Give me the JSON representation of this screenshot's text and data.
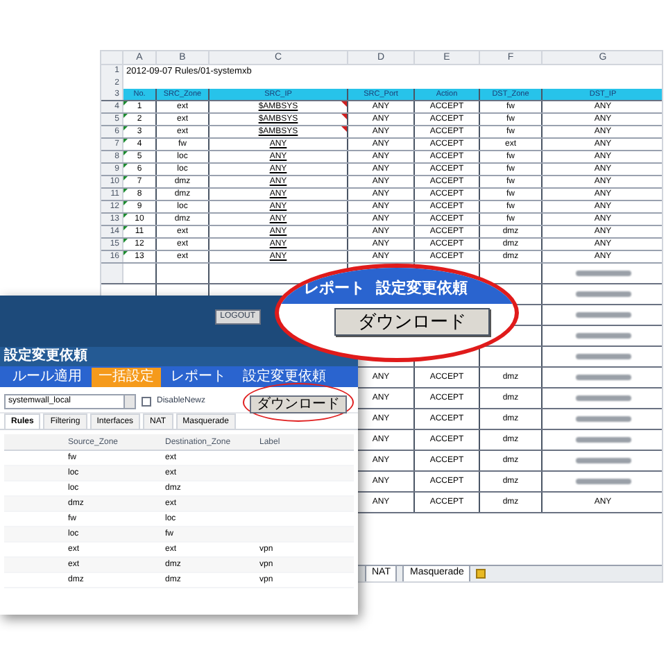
{
  "spreadsheet": {
    "column_headers": [
      "A",
      "B",
      "C",
      "D",
      "E",
      "F",
      "G"
    ],
    "title_row_number": "1",
    "blank_row_number": "2",
    "header_row_number": "3",
    "title": "2012-09-07  Rules/01-systemxb",
    "header": [
      "No.",
      "SRC_Zone",
      "SRC_IP",
      "SRC_Port",
      "Action",
      "DST_Zone",
      "DST_IP"
    ],
    "rows": [
      {
        "row_number": "4",
        "cells": [
          "1",
          "ext",
          "$AMBSYS",
          "ANY",
          "ACCEPT",
          "fw",
          "ANY"
        ],
        "comment": true
      },
      {
        "row_number": "5",
        "cells": [
          "2",
          "ext",
          "$AMBSYS",
          "ANY",
          "ACCEPT",
          "fw",
          "ANY"
        ],
        "comment": true
      },
      {
        "row_number": "6",
        "cells": [
          "3",
          "ext",
          "$AMBSYS",
          "ANY",
          "ACCEPT",
          "fw",
          "ANY"
        ],
        "comment": true
      },
      {
        "row_number": "7",
        "cells": [
          "4",
          "fw",
          "ANY",
          "ANY",
          "ACCEPT",
          "ext",
          "ANY"
        ],
        "comment": false
      },
      {
        "row_number": "8",
        "cells": [
          "5",
          "loc",
          "ANY",
          "ANY",
          "ACCEPT",
          "fw",
          "ANY"
        ],
        "comment": false
      },
      {
        "row_number": "9",
        "cells": [
          "6",
          "loc",
          "ANY",
          "ANY",
          "ACCEPT",
          "fw",
          "ANY"
        ],
        "comment": false
      },
      {
        "row_number": "10",
        "cells": [
          "7",
          "dmz",
          "ANY",
          "ANY",
          "ACCEPT",
          "fw",
          "ANY"
        ],
        "comment": false
      },
      {
        "row_number": "11",
        "cells": [
          "8",
          "dmz",
          "ANY",
          "ANY",
          "ACCEPT",
          "fw",
          "ANY"
        ],
        "comment": false
      },
      {
        "row_number": "12",
        "cells": [
          "9",
          "loc",
          "ANY",
          "ANY",
          "ACCEPT",
          "fw",
          "ANY"
        ],
        "comment": false
      },
      {
        "row_number": "13",
        "cells": [
          "10",
          "dmz",
          "ANY",
          "ANY",
          "ACCEPT",
          "fw",
          "ANY"
        ],
        "comment": false
      },
      {
        "row_number": "14",
        "cells": [
          "11",
          "ext",
          "ANY",
          "ANY",
          "ACCEPT",
          "dmz",
          "ANY"
        ],
        "comment": false
      },
      {
        "row_number": "15",
        "cells": [
          "12",
          "ext",
          "ANY",
          "ANY",
          "ACCEPT",
          "dmz",
          "ANY"
        ],
        "comment": false
      },
      {
        "row_number": "16",
        "cells": [
          "13",
          "ext",
          "ANY",
          "ANY",
          "ACCEPT",
          "dmz",
          "ANY"
        ],
        "comment": false
      }
    ],
    "lower_rows": [
      {
        "kind": "covered"
      },
      {
        "kind": "covered"
      },
      {
        "kind": "covered"
      },
      {
        "kind": "covered"
      },
      {
        "kind": "covered"
      },
      {
        "kind": "full",
        "src_port": "ANY",
        "action": "ACCEPT",
        "dst_zone": "dmz"
      },
      {
        "kind": "full",
        "src_port": "ANY",
        "action": "ACCEPT",
        "dst_zone": "dmz"
      },
      {
        "kind": "full",
        "src_port": "ANY",
        "action": "ACCEPT",
        "dst_zone": "dmz"
      },
      {
        "kind": "full",
        "src_port": "ANY",
        "action": "ACCEPT",
        "dst_zone": "dmz"
      },
      {
        "kind": "full",
        "src_port": "ANY",
        "action": "ACCEPT",
        "dst_zone": "dmz"
      },
      {
        "kind": "full",
        "src_port": "ANY",
        "action": "ACCEPT",
        "dst_zone": "dmz"
      },
      {
        "kind": "full",
        "src_port": "ANY",
        "action": "ACCEPT",
        "dst_zone": "dmz",
        "dst_ip": "ANY"
      }
    ],
    "sheet_tabs": [
      "NAT",
      "Masquerade"
    ]
  },
  "web_window": {
    "header_button": "LOGOUT",
    "title": "設定変更依頼",
    "nav": [
      {
        "label": "ルール適用",
        "selected": false
      },
      {
        "label": "一括設定",
        "selected": true
      },
      {
        "label": "レポート",
        "selected": false
      },
      {
        "label": "設定変更依頼",
        "selected": false
      }
    ],
    "select": {
      "value": "systemwall_local"
    },
    "checkbox": {
      "label": "DisableNewz",
      "checked": false
    },
    "download_button": "ダウンロード",
    "tabs": [
      {
        "label": "Rules",
        "selected": true
      },
      {
        "label": "Filtering",
        "selected": false
      },
      {
        "label": "Interfaces",
        "selected": false
      },
      {
        "label": "NAT",
        "selected": false
      },
      {
        "label": "Masquerade",
        "selected": false
      }
    ],
    "table": {
      "columns": [
        "Source_Zone",
        "Destination_Zone",
        "Label"
      ],
      "rows": [
        [
          "fw",
          "ext"
        ],
        [
          "loc",
          "ext"
        ],
        [
          "loc",
          "dmz"
        ],
        [
          "dmz",
          "ext"
        ],
        [
          "fw",
          "loc"
        ],
        [
          "loc",
          "fw"
        ],
        [
          "ext",
          "ext",
          "vpn"
        ],
        [
          "ext",
          "dmz",
          "vpn"
        ],
        [
          "dmz",
          "dmz",
          "vpn"
        ]
      ]
    }
  },
  "magnifier": {
    "nav": [
      "レポート",
      "設定変更依頼"
    ],
    "button": "ダウンロード"
  }
}
